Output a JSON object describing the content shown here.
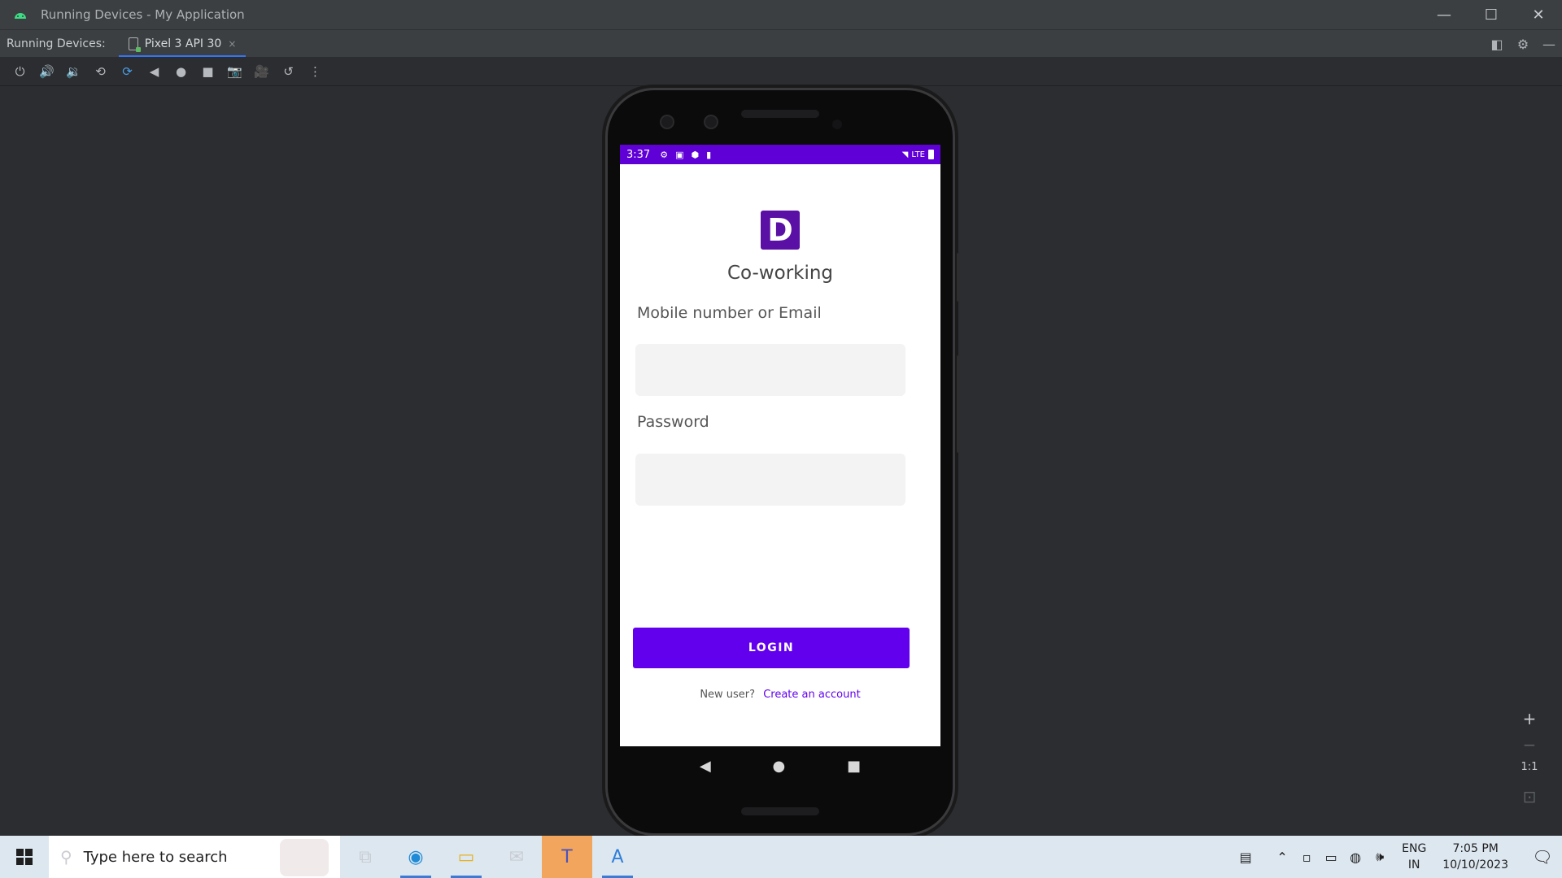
{
  "window": {
    "title": "Running Devices - My Application",
    "controls": {
      "minimize": "—",
      "maximize": "☐",
      "close": "✕"
    }
  },
  "tabbar": {
    "label": "Running Devices:",
    "tab_label": "Pixel 3 API 30",
    "tab_close": "×",
    "right_icons": [
      "layout-icon",
      "gear-icon",
      "hide-icon"
    ]
  },
  "toolbar": {
    "buttons": [
      "power",
      "volume-up",
      "volume-down",
      "rotate-left",
      "rotate-right",
      "back",
      "home",
      "overview",
      "screenshot",
      "screen-record",
      "reset",
      "more"
    ]
  },
  "device": {
    "status": {
      "time": "3:37",
      "network": "LTE"
    },
    "app_name": "Co-working",
    "logo_letter": "D",
    "logo_color": "#5a0fa5",
    "accent_color": "#6200ee",
    "fields": [
      {
        "label": "Mobile number or Email",
        "value": ""
      },
      {
        "label": "Password",
        "value": ""
      }
    ],
    "login_label": "LOGIN",
    "signup_prompt": "New user?",
    "signup_link": "Create an account"
  },
  "zoom": {
    "zoom_in": "+",
    "zoom_out": "−",
    "actual_size": "1:1"
  },
  "taskbar": {
    "search_placeholder": "Type here to search",
    "language": {
      "line1": "ENG",
      "line2": "IN"
    },
    "time": "7:05 PM",
    "date": "10/10/2023"
  }
}
